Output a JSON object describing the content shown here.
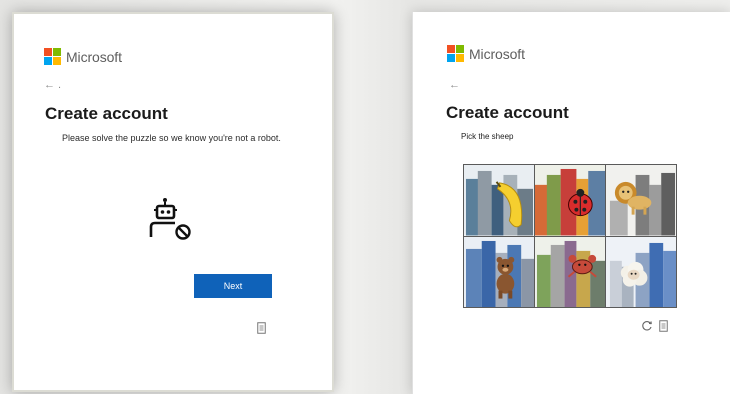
{
  "brand": {
    "name": "Microsoft",
    "colors": [
      "#f25022",
      "#7fba00",
      "#00a4ef",
      "#ffb900"
    ]
  },
  "left_card": {
    "back_glyph": "← .",
    "title": "Create account",
    "description": "Please solve the puzzle so we know you're not a robot.",
    "illustration_icon": "robot-blocked-icon",
    "next_label": "Next",
    "footer_icon": "document-icon"
  },
  "right_card": {
    "back_glyph": "←",
    "title": "Create account",
    "prompt": "Pick the sheep",
    "tiles": [
      {
        "animal": "banana-icon"
      },
      {
        "animal": "ladybug-icon"
      },
      {
        "animal": "lion-icon"
      },
      {
        "animal": "bear-icon"
      },
      {
        "animal": "crab-icon"
      },
      {
        "animal": "sheep-icon"
      }
    ],
    "footer_icons": [
      "refresh-icon",
      "document-icon"
    ]
  },
  "colors": {
    "primary_button": "#0f62b9",
    "title_text": "#1b1b1b"
  }
}
